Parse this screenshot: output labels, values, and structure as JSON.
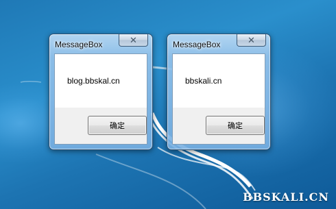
{
  "desktop": {
    "background_color": "#1f79b6",
    "watermark": "BBSKALI.CN"
  },
  "windows": [
    {
      "title": "MessageBox",
      "close_icon": "close-icon",
      "message": "blog.bbskal.cn",
      "ok_label": "确定"
    },
    {
      "title": "MessageBox",
      "close_icon": "close-icon",
      "message": "bbskali.cn",
      "ok_label": "确定"
    }
  ]
}
